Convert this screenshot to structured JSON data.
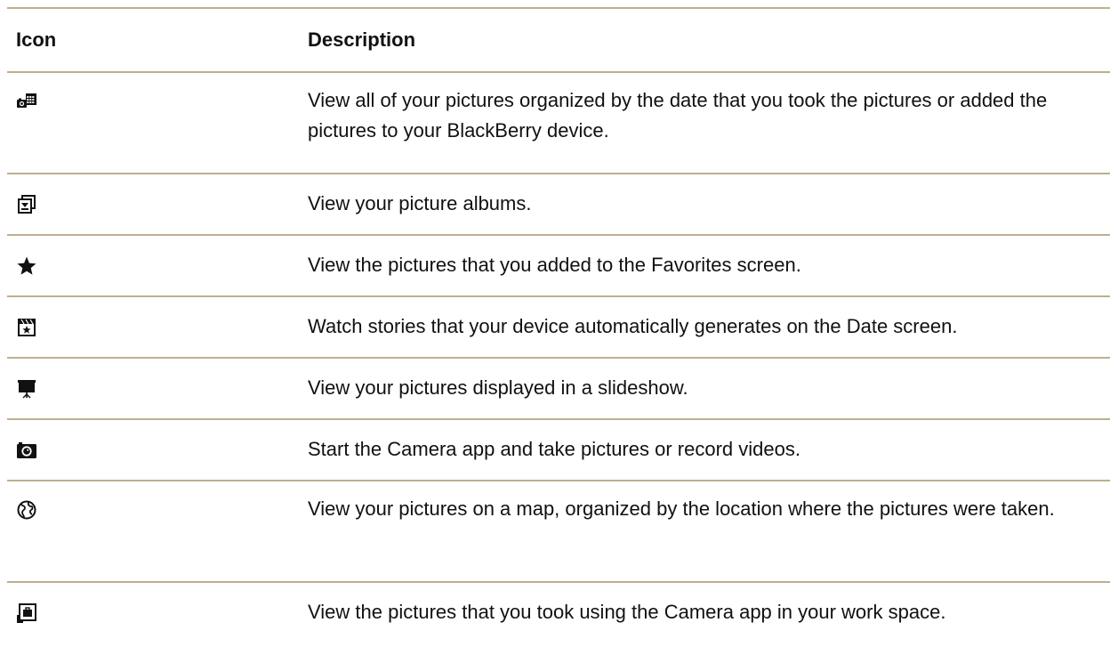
{
  "table": {
    "header": {
      "icon": "Icon",
      "description": "Description"
    },
    "rows": [
      {
        "icon": "camera-calendar-icon",
        "description": "View all of your pictures organized by the date that you took the pictures or added the pictures to your BlackBerry device."
      },
      {
        "icon": "albums-icon",
        "description": "View your picture albums."
      },
      {
        "icon": "star-icon",
        "description": "View the pictures that you added to the Favorites screen."
      },
      {
        "icon": "story-icon",
        "description": "Watch stories that your device automatically generates on the Date screen."
      },
      {
        "icon": "slideshow-icon",
        "description": "View your pictures displayed in a slideshow."
      },
      {
        "icon": "camera-icon",
        "description": "Start the Camera app and take pictures or record videos."
      },
      {
        "icon": "globe-icon",
        "description": "View your pictures on a map, organized by the location where the pictures were taken."
      },
      {
        "icon": "work-space-icon",
        "description": "View the pictures that you took using the Camera app in your work space."
      }
    ]
  },
  "colors": {
    "rule": "#bfae90",
    "text": "#111111"
  }
}
